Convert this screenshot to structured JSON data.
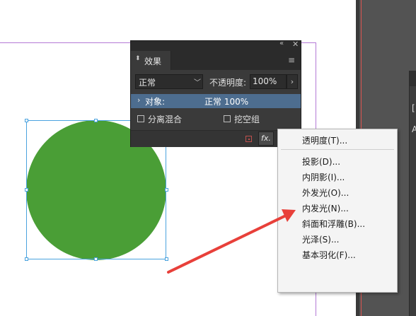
{
  "effects_panel": {
    "tab_title": "效果",
    "blend_mode": "正常",
    "opacity_label": "不透明度:",
    "opacity_value": "100%",
    "object_row": {
      "label": "对象:",
      "value": "正常 100%"
    },
    "isolate_blending_label": "分离混合",
    "knockout_group_label": "挖空组",
    "fx_label": "fx."
  },
  "fx_menu": {
    "items": [
      "透明度(T)...",
      "投影(D)...",
      "内阴影(I)...",
      "外发光(O)...",
      "内发光(N)...",
      "斜面和浮雕(B)...",
      "光泽(S)...",
      "基本羽化(F)..."
    ]
  },
  "right_panel": {
    "text1": "[",
    "text2": "A"
  },
  "colors": {
    "circle_fill": "#4a9e36",
    "selection": "#4aa3df",
    "panel_bg": "#3a3a3a",
    "object_row_highlight": "#4d6d8f",
    "annotation_arrow": "#e8403a"
  }
}
